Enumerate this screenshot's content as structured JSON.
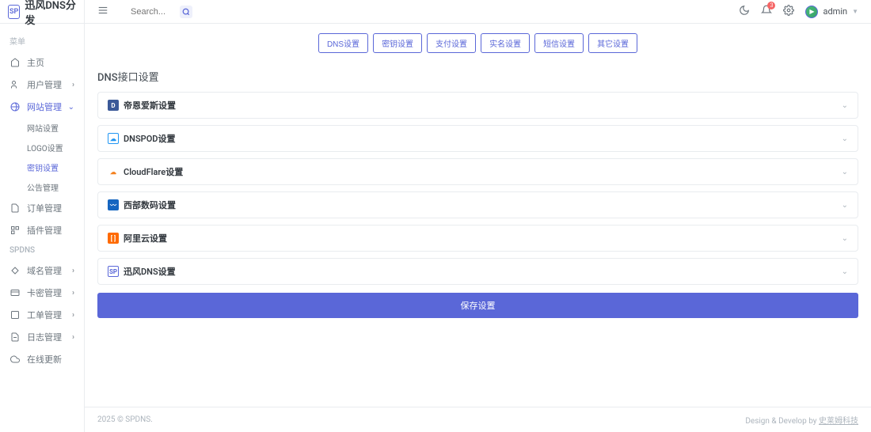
{
  "brand": {
    "logo_text": "SP",
    "name": "迅风DNS分发"
  },
  "search": {
    "placeholder": "Search..."
  },
  "notifications": {
    "count": "3"
  },
  "user": {
    "name": "admin"
  },
  "menu": {
    "section1": "菜单",
    "home": "主页",
    "users": "用户管理",
    "site": "网站管理",
    "site_sub": {
      "web": "网站设置",
      "logo": "LOGO设置",
      "key": "密钥设置",
      "notice": "公告管理"
    },
    "orders": "订单管理",
    "plugins": "插件管理",
    "section2": "SPDNS",
    "domain": "域名管理",
    "card": "卡密管理",
    "ticket": "工单管理",
    "log": "日志管理",
    "update": "在线更新"
  },
  "tabs": {
    "dns": "DNS设置",
    "key": "密钥设置",
    "pay": "支付设置",
    "real": "实名设置",
    "sms": "短信设置",
    "other": "其它设置"
  },
  "page": {
    "title": "DNS接口设置"
  },
  "providers": {
    "dnscom": "帝恩爱斯设置",
    "dnspod": "DNSPOD设置",
    "cloudflare": "CloudFlare设置",
    "west": "西部数码设置",
    "aliyun": "阿里云设置",
    "spdns": "迅风DNS设置"
  },
  "actions": {
    "save": "保存设置"
  },
  "footer": {
    "copyright": "2025 © SPDNS.",
    "design": "Design & Develop by ",
    "company": "史莱姆科技"
  }
}
